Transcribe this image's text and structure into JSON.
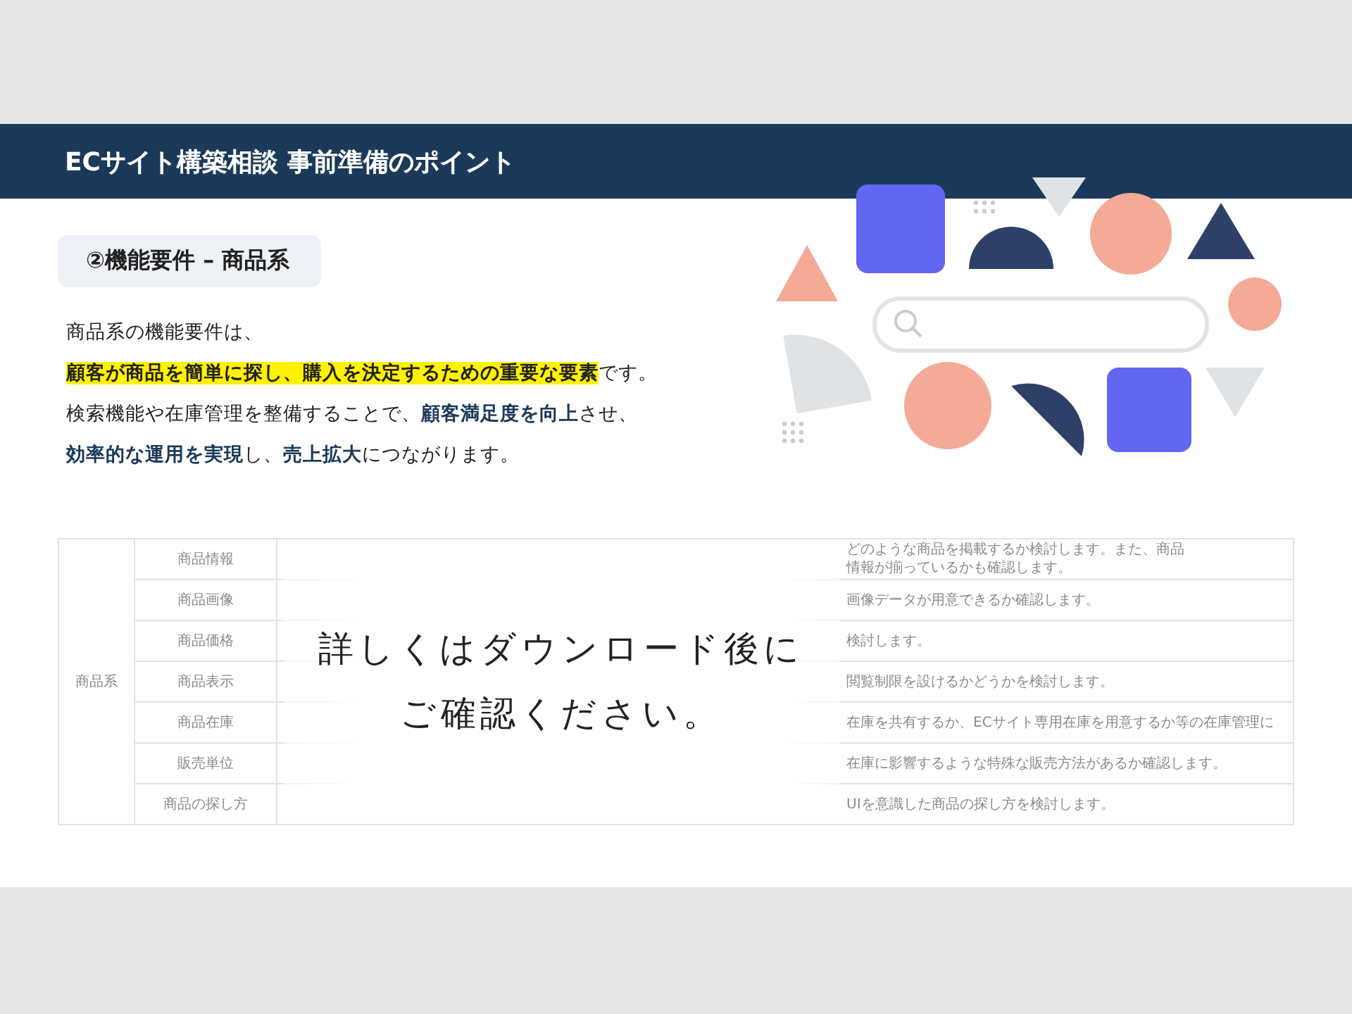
{
  "header": {
    "title": "ECサイト構築相談 事前準備のポイント"
  },
  "section_label": "②機能要件 – 商品系",
  "body_lines": [
    [
      {
        "text": "商品系の機能要件は、",
        "kind": "plain"
      }
    ],
    [
      {
        "text": "顧客が商品を簡単に探し、購入を決定するための重要な要素",
        "kind": "highlight"
      },
      {
        "text": "です。",
        "kind": "plain"
      }
    ],
    [
      {
        "text": "検索機能や在庫管理を整備することで、",
        "kind": "plain"
      },
      {
        "text": "顧客満足度を向上",
        "kind": "accent"
      },
      {
        "text": "させ、",
        "kind": "plain"
      }
    ],
    [
      {
        "text": "効率的な運用を実現",
        "kind": "accent"
      },
      {
        "text": "し、",
        "kind": "plain"
      },
      {
        "text": "売上拡大",
        "kind": "accent"
      },
      {
        "text": "につながります。",
        "kind": "plain"
      }
    ]
  ],
  "table": {
    "category": "商品系",
    "rows": [
      {
        "item": "商品情報",
        "description": [
          "どのような商品を掲載するか検討します。また、商品",
          "情報が揃っているかも確認します。"
        ]
      },
      {
        "item": "商品画像",
        "description": [
          "画像データが用意できるか確認します。"
        ]
      },
      {
        "item": "商品価格",
        "description": [
          "検討します。"
        ]
      },
      {
        "item": "商品表示",
        "description": [
          "閲覧制限を設けるかどうかを検討します。"
        ]
      },
      {
        "item": "商品在庫",
        "description": [
          "在庫を共有するか、ECサイト専用在庫を用意するか等の在庫管理に"
        ]
      },
      {
        "item": "販売単位",
        "description": [
          "在庫に影響するような特殊な販売方法があるか確認します。"
        ]
      },
      {
        "item": "商品の探し方",
        "description": [
          "UIを意識した商品の探し方を検討します。"
        ]
      }
    ]
  },
  "overlay": {
    "lines": [
      "詳しくはダウンロード後に",
      "ご確認ください。"
    ]
  }
}
